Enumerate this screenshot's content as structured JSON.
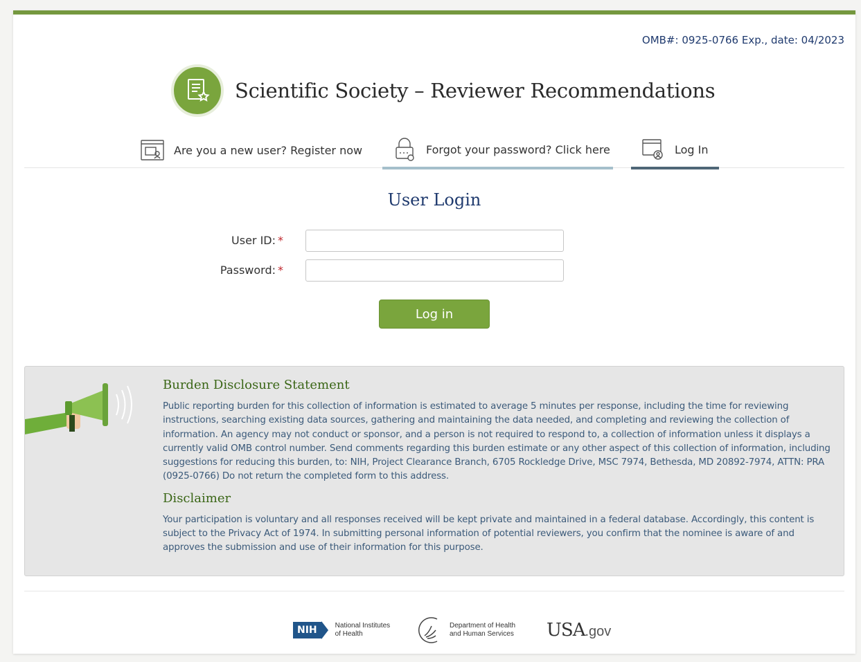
{
  "header": {
    "omb": "OMB#: 0925-0766 Exp., date: 04/2023",
    "title": "Scientific Society – Reviewer Recommendations",
    "logo_icon": "document-star-icon"
  },
  "tabs": [
    {
      "label": "Are you a new user? Register now",
      "icon": "register-window-icon"
    },
    {
      "label": "Forgot your password? Click here",
      "icon": "padlock-icon"
    },
    {
      "label": "Log In",
      "icon": "user-window-icon"
    }
  ],
  "login": {
    "heading": "User Login",
    "user_id_label": "User ID:",
    "password_label": "Password:",
    "required_mark": "*",
    "user_id_value": "",
    "password_value": "",
    "button_label": "Log in"
  },
  "disclosure": {
    "burden_title": "Burden Disclosure Statement",
    "burden_text": "Public reporting burden for this collection of information is estimated to average 5 minutes per response, including the time for reviewing instructions, searching existing data sources, gathering and maintaining the data needed, and completing and reviewing the collection of information. An agency may not conduct or sponsor, and a person is not required to respond to, a collection of information unless it displays a currently valid OMB control number. Send comments regarding this burden estimate or any other aspect of this collection of information, including suggestions for reducing this burden, to: NIH, Project Clearance Branch, 6705 Rockledge Drive, MSC 7974, Bethesda, MD 20892-7974, ATTN: PRA (0925-0766) Do not return the completed form to this address.",
    "disclaimer_title": "Disclaimer",
    "disclaimer_text": "Your participation is voluntary and all responses received will be kept private and maintained in a federal database. Accordingly, this content is subject to the Privacy Act of 1974. In submitting personal information of potential reviewers, you confirm that the nominee is aware of and approves the submission and use of their information for this purpose."
  },
  "footer": {
    "nih_badge": "NIH",
    "nih_line1": "National Institutes",
    "nih_line2": "of Health",
    "hhs_line1": "Department of Health",
    "hhs_line2": "and Human Services",
    "usa_main": "USA",
    "usa_suffix": ".gov"
  },
  "colors": {
    "accent_green": "#7aa53d",
    "navy": "#1f3a6e",
    "required_red": "#c0262c",
    "panel_gray": "#e6e6e6"
  }
}
